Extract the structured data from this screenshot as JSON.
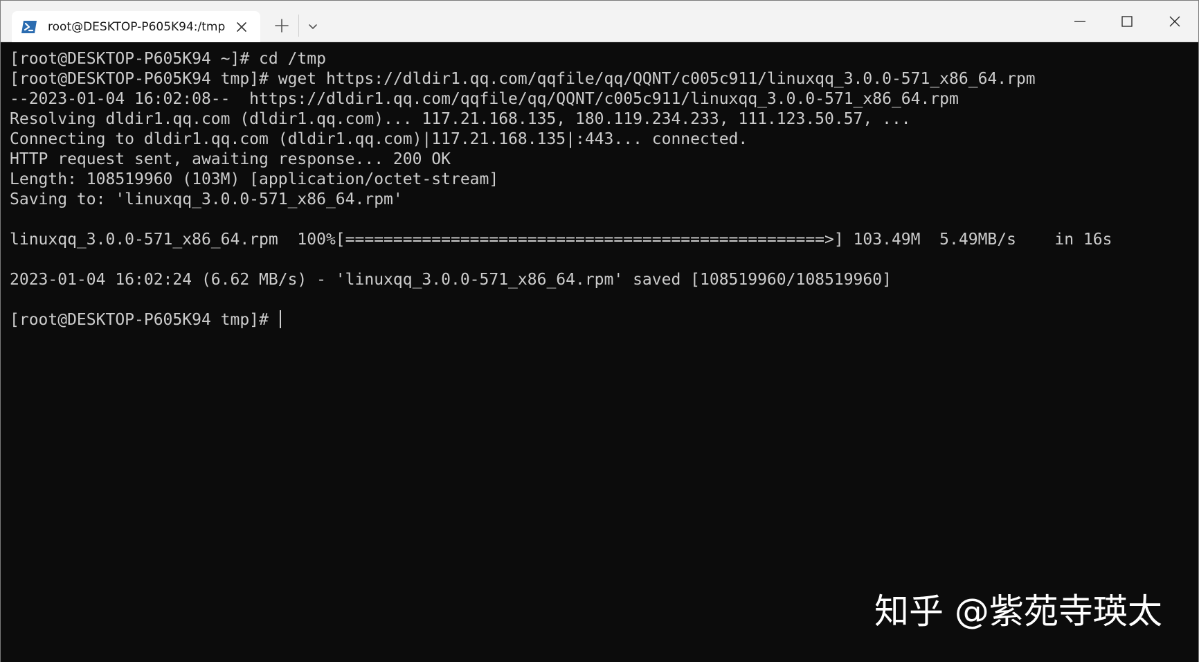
{
  "window": {
    "tab": {
      "title": "root@DESKTOP-P605K94:/tmp",
      "icon": "powershell-icon"
    },
    "controls": [
      "minimize-icon",
      "maximize-icon",
      "close-icon"
    ]
  },
  "terminal": {
    "lines": [
      "[root@DESKTOP-P605K94 ~]# cd /tmp",
      "[root@DESKTOP-P605K94 tmp]# wget https://dldir1.qq.com/qqfile/qq/QQNT/c005c911/linuxqq_3.0.0-571_x86_64.rpm",
      "--2023-01-04 16:02:08--  https://dldir1.qq.com/qqfile/qq/QQNT/c005c911/linuxqq_3.0.0-571_x86_64.rpm",
      "Resolving dldir1.qq.com (dldir1.qq.com)... 117.21.168.135, 180.119.234.233, 111.123.50.57, ...",
      "Connecting to dldir1.qq.com (dldir1.qq.com)|117.21.168.135|:443... connected.",
      "HTTP request sent, awaiting response... 200 OK",
      "Length: 108519960 (103M) [application/octet-stream]",
      "Saving to: 'linuxqq_3.0.0-571_x86_64.rpm'",
      "",
      "linuxqq_3.0.0-571_x86_64.rpm  100%[==================================================>] 103.49M  5.49MB/s    in 16s",
      "",
      "2023-01-04 16:02:24 (6.62 MB/s) - 'linuxqq_3.0.0-571_x86_64.rpm' saved [108519960/108519960]",
      ""
    ],
    "prompt": "[root@DESKTOP-P605K94 tmp]# "
  },
  "watermark": "知乎 @紫苑寺瑛太",
  "colors": {
    "background": "#0c0c0c",
    "foreground": "#cccccc",
    "titlebar": "#f3f3f3",
    "tab": "#ffffff",
    "tab_icon": "#2b6cb0"
  }
}
